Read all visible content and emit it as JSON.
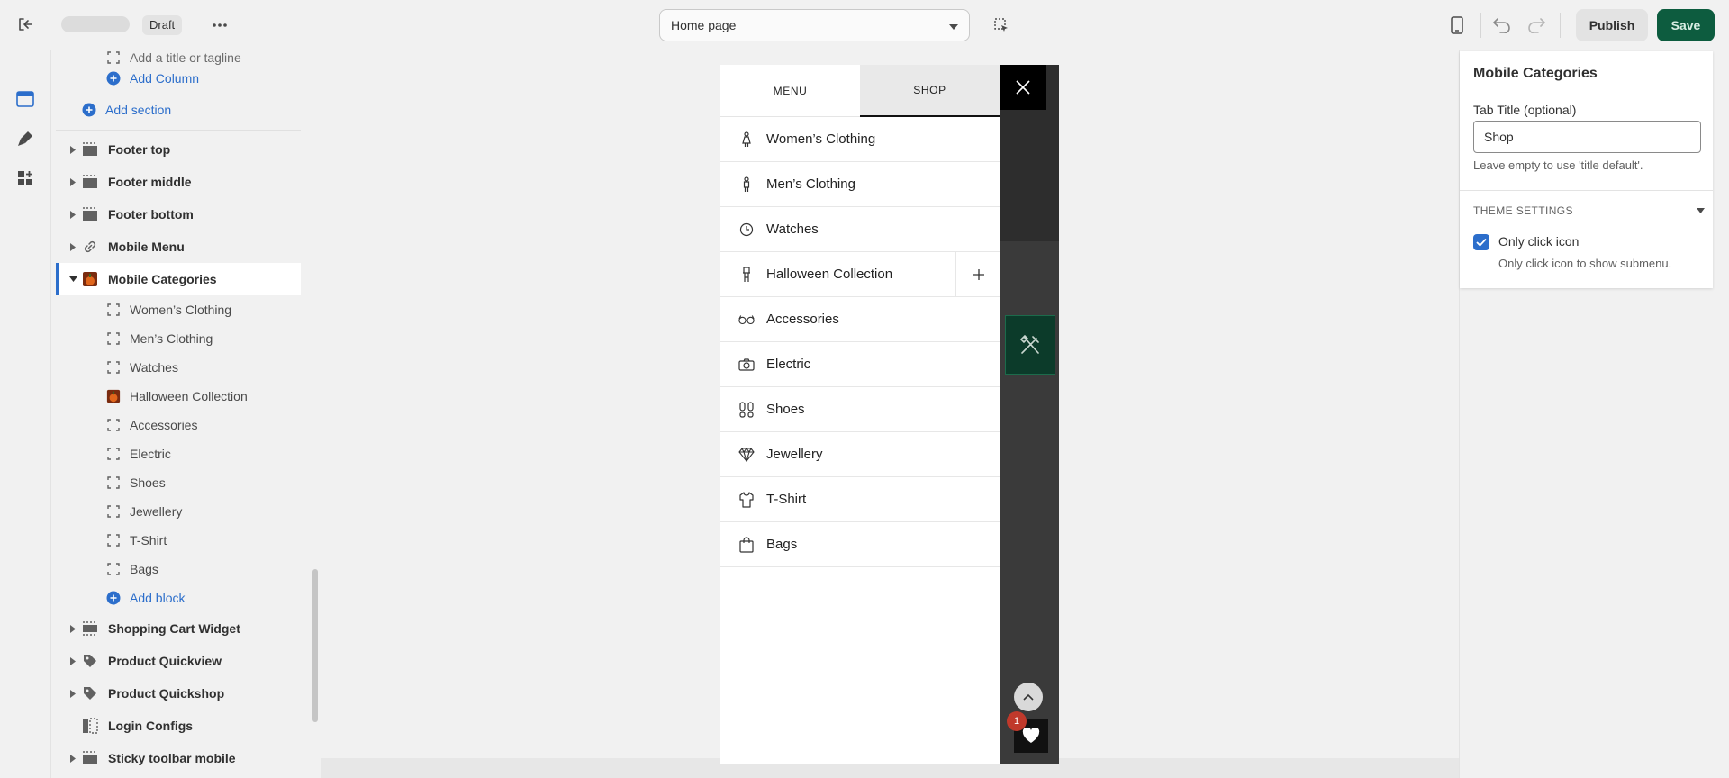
{
  "topbar": {
    "draft_label": "Draft",
    "page_select_value": "Home page",
    "publish_label": "Publish",
    "save_label": "Save"
  },
  "sidebar": {
    "truncated_top": "Add a title or tagline",
    "add_column": "Add Column",
    "add_section": "Add section",
    "sections": [
      {
        "label": "Footer top"
      },
      {
        "label": "Footer middle"
      },
      {
        "label": "Footer bottom"
      },
      {
        "label": "Mobile Menu"
      },
      {
        "label": "Mobile Categories"
      }
    ],
    "blocks": [
      {
        "label": "Women’s Clothing"
      },
      {
        "label": "Men’s Clothing"
      },
      {
        "label": "Watches"
      },
      {
        "label": "Halloween Collection"
      },
      {
        "label": "Accessories"
      },
      {
        "label": "Electric"
      },
      {
        "label": "Shoes"
      },
      {
        "label": "Jewellery"
      },
      {
        "label": "T-Shirt"
      },
      {
        "label": "Bags"
      }
    ],
    "add_block": "Add block",
    "sections_after": [
      {
        "label": "Shopping Cart Widget"
      },
      {
        "label": "Product Quickview"
      },
      {
        "label": "Product Quickshop"
      },
      {
        "label": "Login Configs"
      },
      {
        "label": "Sticky toolbar mobile"
      }
    ]
  },
  "preview": {
    "tabs": {
      "menu": "MENU",
      "shop": "SHOP"
    },
    "categories": [
      {
        "label": "Women’s Clothing",
        "icon": "woman-icon"
      },
      {
        "label": "Men’s Clothing",
        "icon": "man-icon"
      },
      {
        "label": "Watches",
        "icon": "clock-icon"
      },
      {
        "label": "Halloween Collection",
        "icon": "halloween-icon"
      },
      {
        "label": "Accessories",
        "icon": "glasses-icon"
      },
      {
        "label": "Electric",
        "icon": "camera-icon"
      },
      {
        "label": "Shoes",
        "icon": "footprints-icon"
      },
      {
        "label": "Jewellery",
        "icon": "diamond-icon"
      },
      {
        "label": "T-Shirt",
        "icon": "tshirt-icon"
      },
      {
        "label": "Bags",
        "icon": "bag-icon"
      }
    ],
    "wishlist_count": "1"
  },
  "settings": {
    "title": "Mobile Categories",
    "tab_title_label": "Tab Title (optional)",
    "tab_title_value": "Shop",
    "tab_title_help": "Leave empty to use 'title default'.",
    "section_heading": "THEME SETTINGS",
    "only_click_icon_label": "Only click icon",
    "only_click_icon_help": "Only click icon to show submenu.",
    "only_click_icon_checked": true
  },
  "colors": {
    "accent_blue": "#2c6ecb",
    "save_green": "#0d5c3f"
  }
}
